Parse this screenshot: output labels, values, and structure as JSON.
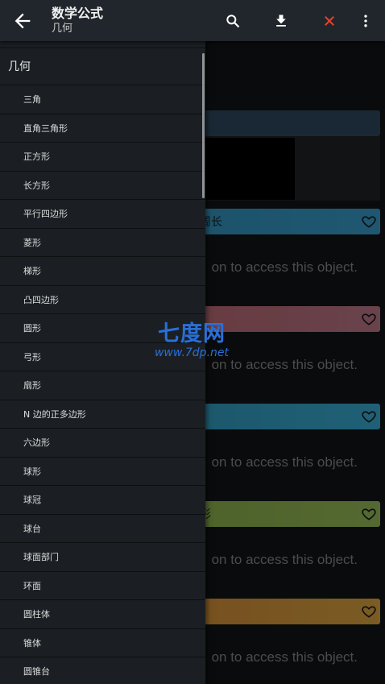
{
  "appbar": {
    "title": "数学公式",
    "subtitle": "几何",
    "icons": [
      "arrow-back-icon",
      "search-icon",
      "download-icon",
      "close-icon",
      "more-vert-icon"
    ],
    "close_color": "#e8412c"
  },
  "drawer": {
    "section_label": "几何",
    "items": [
      "三角",
      "直角三角形",
      "正方形",
      "长方形",
      "平行四边形",
      "菱形",
      "梯形",
      "凸四边形",
      "圆形",
      "弓形",
      "扇形",
      "N 边的正多边形",
      "六边形",
      "球形",
      "球冠",
      "球台",
      "球面部门",
      "环面",
      "圆柱体",
      "锥体",
      "圆锥台"
    ]
  },
  "content": {
    "cards": [
      {
        "title_fragment": "",
        "message": "",
        "gradient": [
          "#2e4a60",
          "#2e4a60"
        ]
      },
      {
        "title_fragment": "周长",
        "message": "on to access this object.",
        "gradient": [
          "#2e8fb5",
          "#3a9fd0"
        ]
      },
      {
        "title_fragment": "",
        "message": "on to access this object.",
        "gradient": [
          "#b85c5c",
          "#c07a8c"
        ]
      },
      {
        "title_fragment": "",
        "message": "on to access this object.",
        "gradient": [
          "#2a8fb0",
          "#3bb0d8"
        ]
      },
      {
        "title_fragment": "形",
        "message": "on to access this object.",
        "gradient": [
          "#7fa840",
          "#9ac05a"
        ]
      },
      {
        "title_fragment": "",
        "message": "on to access this object.",
        "gradient": [
          "#d17a35",
          "#e0a840"
        ]
      }
    ]
  },
  "watermark": {
    "main": "七度网",
    "url": "www.7dp.net"
  }
}
